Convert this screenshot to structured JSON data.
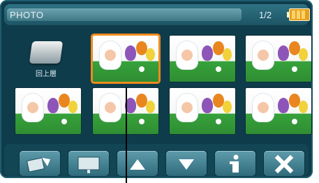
{
  "header": {
    "title": "PHOTO",
    "page_indicator": "1/2",
    "battery_icon": "battery-icon"
  },
  "back_folder": {
    "icon": "folder-icon",
    "label": "回上層"
  },
  "photos": [
    {
      "id": "photo-1",
      "selected": true
    },
    {
      "id": "photo-2",
      "selected": false
    },
    {
      "id": "photo-3",
      "selected": false
    },
    {
      "id": "photo-4",
      "selected": false
    },
    {
      "id": "photo-5",
      "selected": false
    },
    {
      "id": "photo-6",
      "selected": false
    },
    {
      "id": "photo-7",
      "selected": false
    }
  ],
  "toolbar": {
    "buttons": [
      {
        "icon": "rotate-icon"
      },
      {
        "icon": "slideshow-icon"
      },
      {
        "icon": "arrow-up-icon"
      },
      {
        "icon": "arrow-down-icon"
      },
      {
        "icon": "info-icon"
      },
      {
        "icon": "close-icon"
      }
    ]
  },
  "colors": {
    "background": "#0f3c4b",
    "selection": "#f08a1c",
    "text": "#e8f2f5"
  }
}
